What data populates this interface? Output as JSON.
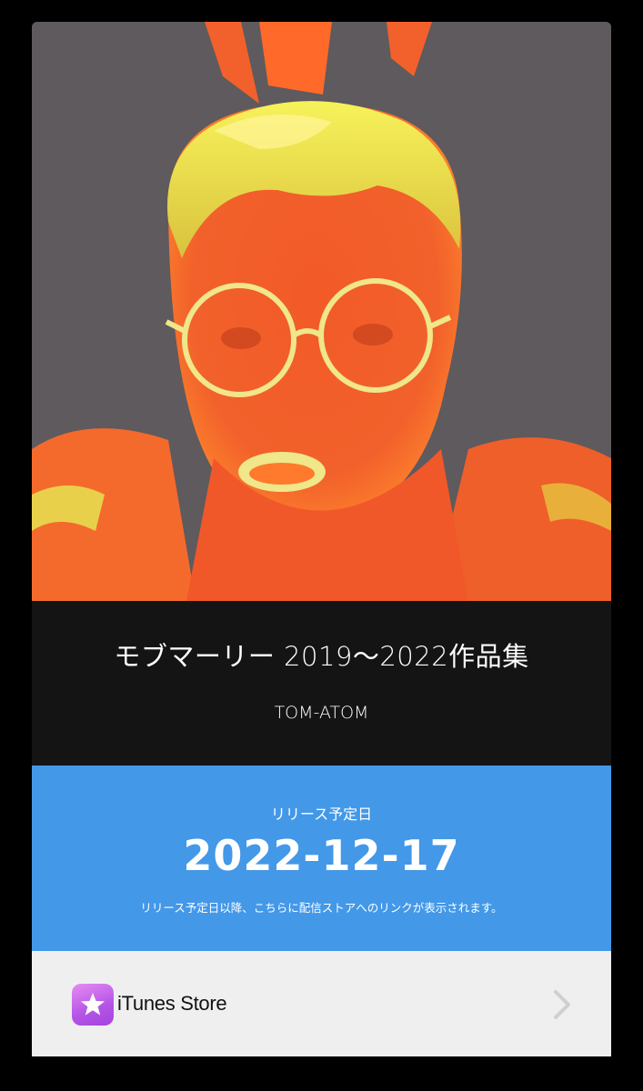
{
  "album": {
    "title": "モブマーリー 2019〜2022作品集",
    "artist": "TOM-ATOM",
    "cover_palette": {
      "background": "#5e5a5e",
      "skin": "#f2612b",
      "glow": "#ff8a2c",
      "highlight": "#e8ec4a"
    }
  },
  "release": {
    "label": "リリース予定日",
    "date": "2022-12-17",
    "note": "リリース予定日以降、こちらに配信ストアへのリンクが表示されます。",
    "color": "#4398e8"
  },
  "store": {
    "name": "iTunes Store",
    "icon": "star-icon",
    "icon_color": "#b454e6"
  }
}
